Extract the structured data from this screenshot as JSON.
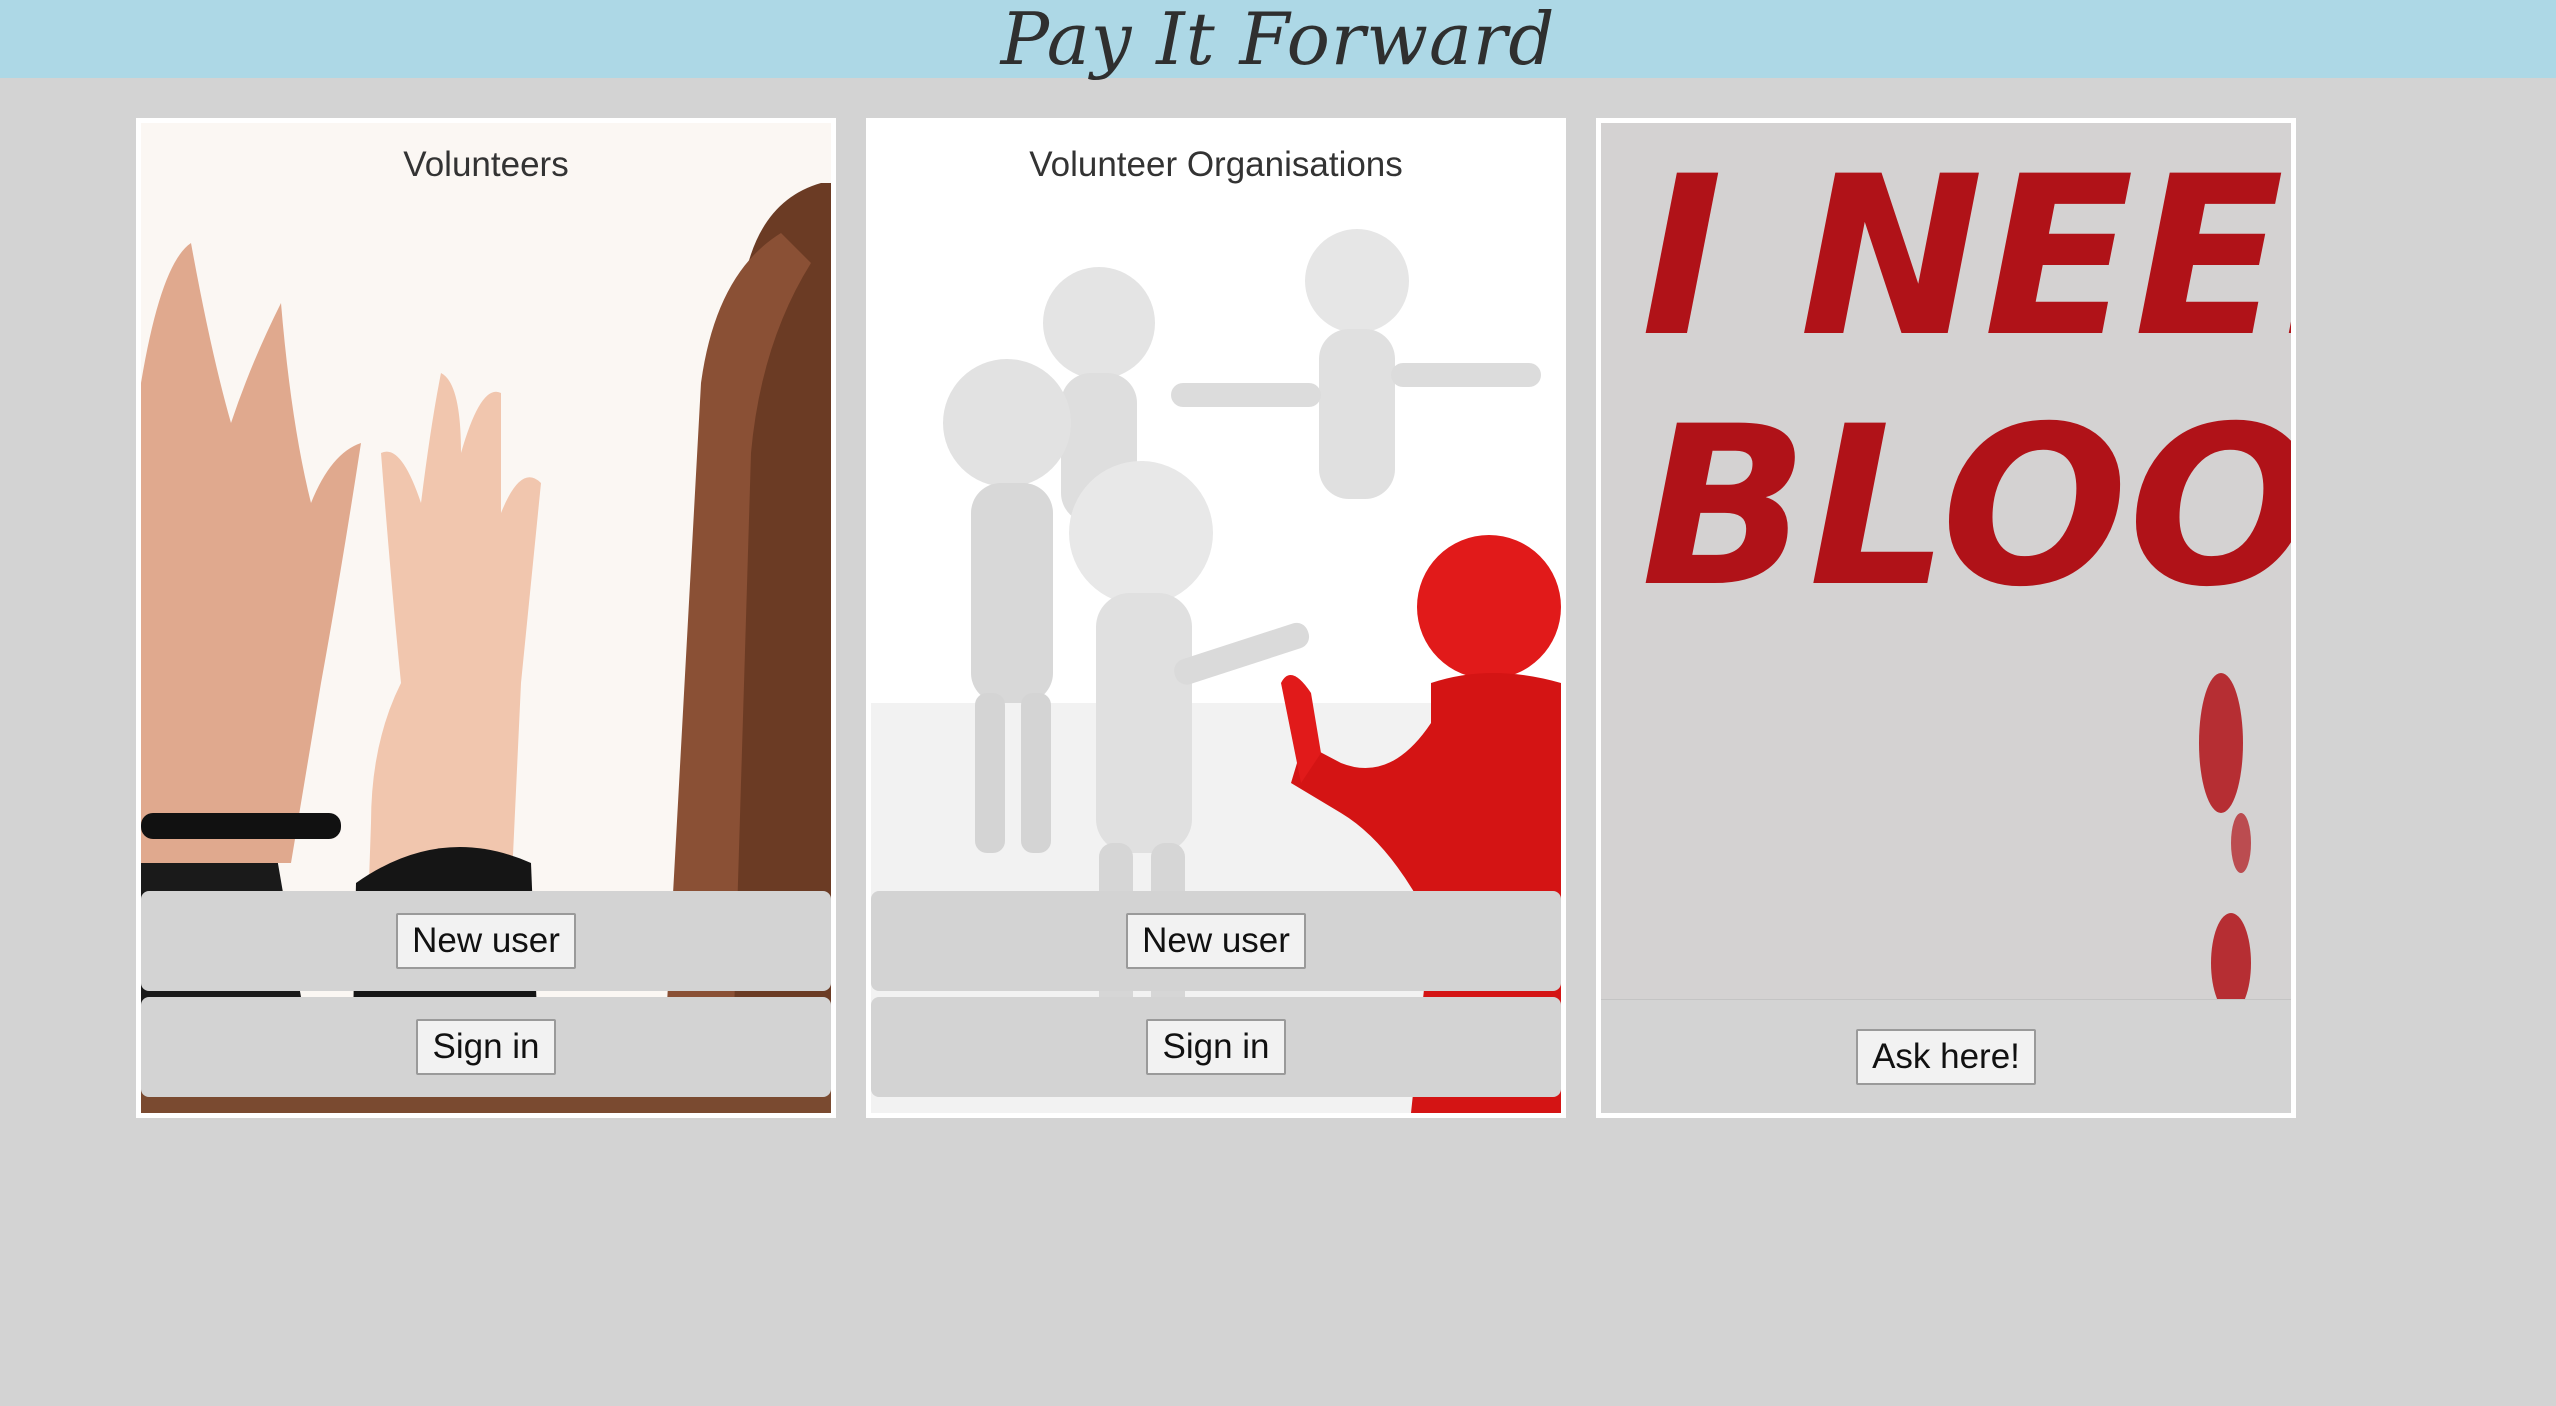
{
  "header": {
    "title": "Pay It Forward"
  },
  "cards": [
    {
      "title": "Volunteers",
      "image_icon": "raised-hands-image",
      "buttons": {
        "new_user": "New user",
        "sign_in": "Sign in"
      }
    },
    {
      "title": "Volunteer Organisations",
      "image_icon": "teamwork-figures-image",
      "buttons": {
        "new_user": "New user",
        "sign_in": "Sign in"
      }
    },
    {
      "title": "",
      "image_icon": "blood-request-image",
      "image_text": [
        "I NEED",
        "BLOOD"
      ],
      "buttons": {
        "ask": "Ask here!"
      }
    }
  ],
  "colors": {
    "header_bg": "#add8e6",
    "page_bg": "#d3d3d3",
    "blood_red": "#b01218",
    "figure_red": "#e11a1a"
  }
}
